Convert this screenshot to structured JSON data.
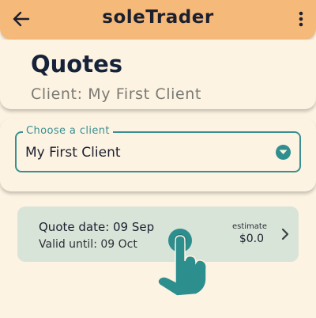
{
  "appbar": {
    "title": "soleTrader",
    "back_icon": "arrow-left-icon",
    "menu_icon": "more-vertical-icon"
  },
  "header": {
    "title": "Quotes",
    "subtitle": "Client: My First Client"
  },
  "client_selector": {
    "label": "Choose a client",
    "value": "My First Client",
    "icon": "chevron-down-circle-icon"
  },
  "quotes": [
    {
      "quote_date": "Quote date: 09 Sep",
      "valid_until": "Valid until: 09 Oct",
      "estimate_label": "estimate",
      "estimate_amount": "$0.0"
    }
  ],
  "overlay": {
    "icon": "tap-hand-icon"
  },
  "colors": {
    "appbar": "#f5b97a",
    "background": "#fdf3e3",
    "accent": "#3a8f90",
    "card": "#d9e4d9",
    "heading": "#152238"
  }
}
